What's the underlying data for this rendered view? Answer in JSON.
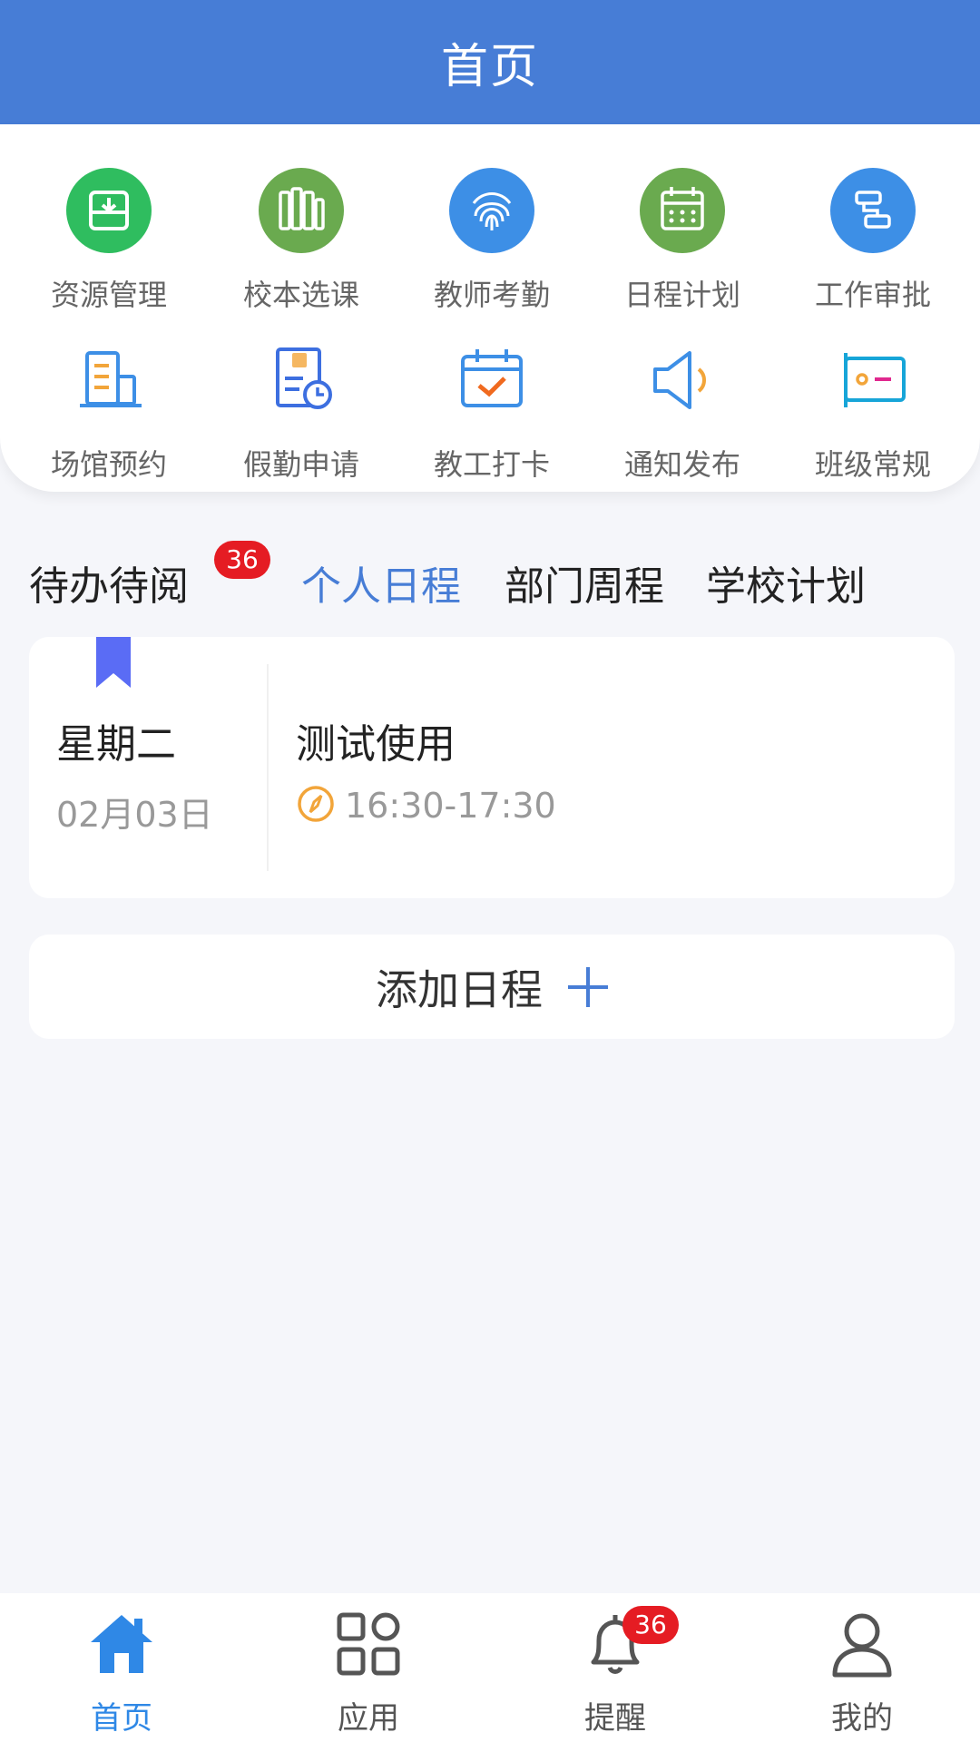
{
  "header": {
    "title": "首页"
  },
  "apps": [
    {
      "label": "资源管理",
      "icon": "inbox-download-icon",
      "color": "#2fbd5f"
    },
    {
      "label": "校本选课",
      "icon": "books-icon",
      "color": "#6aaa4f"
    },
    {
      "label": "教师考勤",
      "icon": "fingerprint-icon",
      "color": "#3d8fe6"
    },
    {
      "label": "日程计划",
      "icon": "calendar-icon",
      "color": "#6aaa4f"
    },
    {
      "label": "工作审批",
      "icon": "approval-flow-icon",
      "color": "#3d8fe6"
    },
    {
      "label": "场馆预约",
      "icon": "building-icon",
      "color": "#3d8fe6"
    },
    {
      "label": "假勤申请",
      "icon": "leave-form-icon",
      "color": "#3d6fe0"
    },
    {
      "label": "教工打卡",
      "icon": "calendar-check-icon",
      "color": "#3d8fe6"
    },
    {
      "label": "通知发布",
      "icon": "speaker-icon",
      "color": "#3d8fe6"
    },
    {
      "label": "班级常规",
      "icon": "id-card-icon",
      "color": "#17a5d8"
    }
  ],
  "tabs": {
    "todo": "待办待阅",
    "todo_badge": "36",
    "personal": "个人日程",
    "department": "部门周程",
    "school": "学校计划"
  },
  "schedule": {
    "weekday": "星期二",
    "date": "02月03日",
    "title": "测试使用",
    "time": "16:30-17:30"
  },
  "add_schedule": {
    "label": "添加日程"
  },
  "nav": {
    "home": "首页",
    "apps": "应用",
    "remind": "提醒",
    "remind_badge": "36",
    "mine": "我的"
  },
  "colors": {
    "primary": "#477dd6",
    "badge": "#e51c23",
    "nav_active": "#2f88e6",
    "bookmark": "#5a6cf5",
    "time_icon": "#f2a53a"
  }
}
